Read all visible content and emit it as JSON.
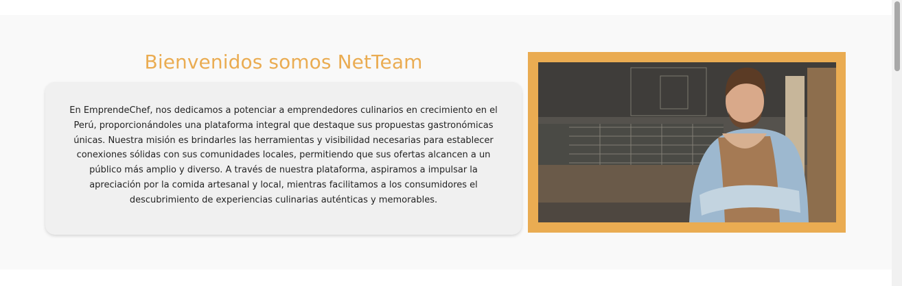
{
  "about": {
    "title": "Bienvenidos somos NetTeam",
    "description": "En EmprendeChef, nos dedicamos a potenciar a emprendedores culinarios en crecimiento en el Perú, proporcionándoles una plataforma integral que destaque sus propuestas gastronómicas únicas. Nuestra misión es brindarles las herramientas y visibilidad necesarias para establecer conexiones sólidas con sus comunidades locales, permitiendo que sus ofertas alcancen a un público más amplio y diverso. A través de nuestra plataforma, aspiramos a impulsar la apreciación por la comida artesanal y local, mientras facilitamos a los consumidores el descubrimiento de experiencias culinarias auténticas y memorables."
  },
  "colors": {
    "accent": "#eaac52",
    "section_background": "#f9f9f9",
    "card_background": "#f0f0f0",
    "text": "#222222"
  }
}
